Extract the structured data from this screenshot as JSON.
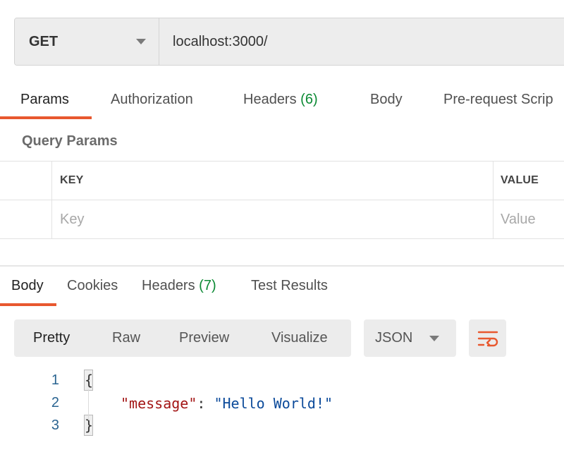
{
  "request": {
    "method": "GET",
    "url": "localhost:3000/"
  },
  "request_tabs": [
    {
      "label": "Params",
      "count": ""
    },
    {
      "label": "Authorization",
      "count": ""
    },
    {
      "label": "Headers",
      "count": "(6)"
    },
    {
      "label": "Body",
      "count": ""
    },
    {
      "label": "Pre-request Scrip",
      "count": ""
    }
  ],
  "query_params": {
    "title": "Query Params",
    "columns": [
      "KEY",
      "VALUE"
    ],
    "placeholders": {
      "key": "Key",
      "value": "Value"
    }
  },
  "response_tabs": [
    {
      "label": "Body",
      "count": ""
    },
    {
      "label": "Cookies",
      "count": ""
    },
    {
      "label": "Headers",
      "count": "(7)"
    },
    {
      "label": "Test Results",
      "count": ""
    }
  ],
  "view_modes": [
    "Pretty",
    "Raw",
    "Preview",
    "Visualize"
  ],
  "format": "JSON",
  "code": {
    "line_numbers": [
      "1",
      "2",
      "3"
    ],
    "open_brace": "{",
    "close_brace": "}",
    "key": "\"message\"",
    "colon": ": ",
    "value": "\"Hello World!\""
  },
  "colors": {
    "accent": "#e8582f",
    "count_green": "#0c8a34",
    "json_key": "#a31515",
    "json_string": "#0b4a9a"
  },
  "icons": {
    "method_dropdown": "chevron-down-icon",
    "format_dropdown": "chevron-down-icon",
    "wrap": "wrap-lines-icon"
  }
}
